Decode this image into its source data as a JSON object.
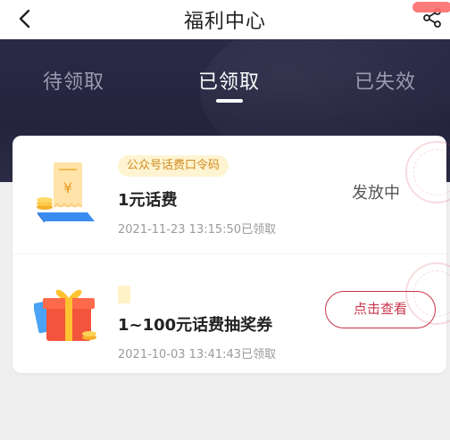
{
  "header": {
    "title": "福利中心",
    "back_icon": "chevron-left-icon",
    "share_icon": "share-icon"
  },
  "tabs": [
    {
      "label": "待领取",
      "active": false
    },
    {
      "label": "已领取",
      "active": true
    },
    {
      "label": "已失效",
      "active": false
    }
  ],
  "coupons": [
    {
      "tag": "公众号话费口令码",
      "title": "1元话费",
      "date": "2021-11-23 13:15:50已领取",
      "status": "发放中",
      "icon": "bill-receipt-icon"
    },
    {
      "tag": "",
      "title": "1~100元话费抽奖券",
      "date": "2021-10-03 13:41:43已领取",
      "action_label": "点击查看",
      "icon": "gift-box-icon"
    }
  ],
  "colors": {
    "tab_bar_bg": "#24243e",
    "accent_red": "#c8344a",
    "tag_bg": "#fff4d1",
    "tag_text": "#d08b1f"
  }
}
